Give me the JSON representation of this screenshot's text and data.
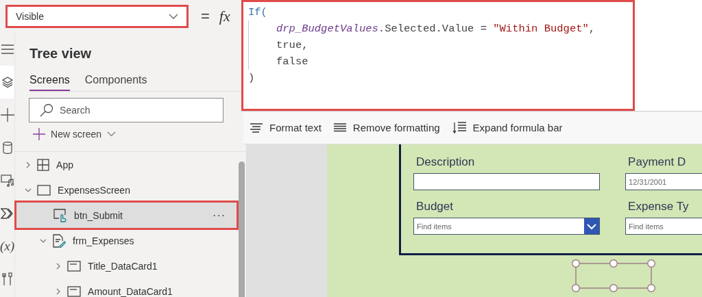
{
  "property_dropdown": {
    "value": "Visible"
  },
  "formula_bar": {
    "equals": "=",
    "fx": "fx",
    "lines": [
      {
        "indented": false,
        "tokens": [
          {
            "kind": "function",
            "text": "If("
          }
        ]
      },
      {
        "indented": true,
        "tokens": [
          {
            "kind": "control",
            "text": "drp_BudgetValues"
          },
          {
            "kind": "plain",
            "text": ".Selected.Value = "
          },
          {
            "kind": "string",
            "text": "\"Within Budget\""
          },
          {
            "kind": "plain",
            "text": ","
          }
        ]
      },
      {
        "indented": true,
        "tokens": [
          {
            "kind": "plain",
            "text": "true,"
          }
        ]
      },
      {
        "indented": true,
        "tokens": [
          {
            "kind": "plain",
            "text": "false"
          }
        ]
      },
      {
        "indented": false,
        "tokens": [
          {
            "kind": "plain",
            "text": ")"
          }
        ]
      }
    ],
    "toolbar": [
      {
        "kind": "format",
        "label": "Format text"
      },
      {
        "kind": "remove",
        "label": "Remove formatting"
      },
      {
        "kind": "expand",
        "label": "Expand formula bar"
      }
    ]
  },
  "rail": [
    {
      "kind": "menu",
      "selected": false
    },
    {
      "kind": "layers",
      "selected": true
    },
    {
      "kind": "plus",
      "selected": false
    },
    {
      "kind": "data",
      "selected": false
    },
    {
      "kind": "media",
      "selected": false
    },
    {
      "kind": "power",
      "selected": false
    },
    {
      "kind": "variables",
      "label": "(x)",
      "selected": false
    },
    {
      "kind": "tools",
      "selected": false
    }
  ],
  "tree_view": {
    "title": "Tree view",
    "tabs": [
      {
        "label": "Screens",
        "selected": true
      },
      {
        "label": "Components",
        "selected": false
      }
    ],
    "search": {
      "placeholder": "Search"
    },
    "new_screen": "New screen",
    "items": [
      {
        "kind": "app",
        "label": "App",
        "expanded": false,
        "selected": false
      },
      {
        "kind": "screen",
        "label": "ExpensesScreen",
        "expanded": true,
        "selected": false,
        "children": [
          {
            "kind": "button",
            "label": "btn_Submit",
            "selected": true,
            "more": "···"
          },
          {
            "kind": "form",
            "label": "frm_Expenses",
            "expanded": true,
            "selected": false,
            "children": [
              {
                "kind": "card",
                "label": "Title_DataCard1",
                "expanded": false,
                "selected": false
              },
              {
                "kind": "card",
                "label": "Amount_DataCard1",
                "expanded": false,
                "selected": false
              }
            ]
          }
        ]
      }
    ]
  },
  "form": {
    "fields": [
      {
        "kind": "text",
        "label": "Description"
      },
      {
        "kind": "text",
        "label": "Payment D",
        "value": "12/31/2001"
      },
      {
        "kind": "combo",
        "label": "Budget",
        "placeholder": "Find items"
      },
      {
        "kind": "combo",
        "label": "Expense Ty",
        "placeholder": "Find items"
      }
    ]
  }
}
